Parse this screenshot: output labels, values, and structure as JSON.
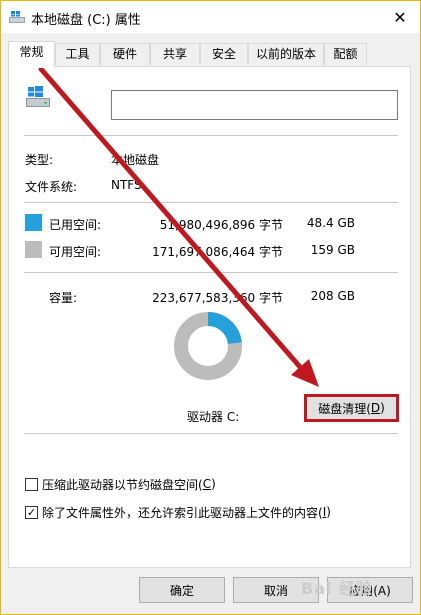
{
  "window": {
    "title": "本地磁盘 (C:) 属性",
    "close_glyph": "✕"
  },
  "tabs": [
    {
      "label": "常规",
      "active": true
    },
    {
      "label": "工具"
    },
    {
      "label": "硬件"
    },
    {
      "label": "共享"
    },
    {
      "label": "安全"
    },
    {
      "label": "以前的版本"
    },
    {
      "label": "配额"
    }
  ],
  "general": {
    "name_value": "",
    "type_label": "类型:",
    "type_value": "本地磁盘",
    "fs_label": "文件系统:",
    "fs_value": "NTFS",
    "used_label": "已用空间:",
    "used_bytes": "51,980,496,896 字节",
    "used_size": "48.4 GB",
    "free_label": "可用空间:",
    "free_bytes": "171,697,086,464 字节",
    "free_size": "159 GB",
    "cap_label": "容量:",
    "cap_bytes": "223,677,583,360 字节",
    "cap_size": "208 GB",
    "drive_label": "驱动器 C:",
    "cleanup_text": "磁盘清理(",
    "cleanup_key": "D",
    "cleanup_end": ")"
  },
  "usage": {
    "used_fraction": 0.232
  },
  "colors": {
    "used": "#26a0da",
    "free": "#bcbcbc",
    "highlight": "#c0181f"
  },
  "options": {
    "compress_text": "压缩此驱动器以节约磁盘空间(",
    "compress_key": "C",
    "compress_end": ")",
    "compress_checked": false,
    "index_text": "除了文件属性外，还允许索引此驱动器上文件的内容(",
    "index_key": "I",
    "index_end": ")",
    "index_checked": true,
    "check_glyph": "✓"
  },
  "buttons": {
    "ok": "确定",
    "cancel": "取消",
    "apply": "应用(A)"
  },
  "watermark": "Bai 经验"
}
